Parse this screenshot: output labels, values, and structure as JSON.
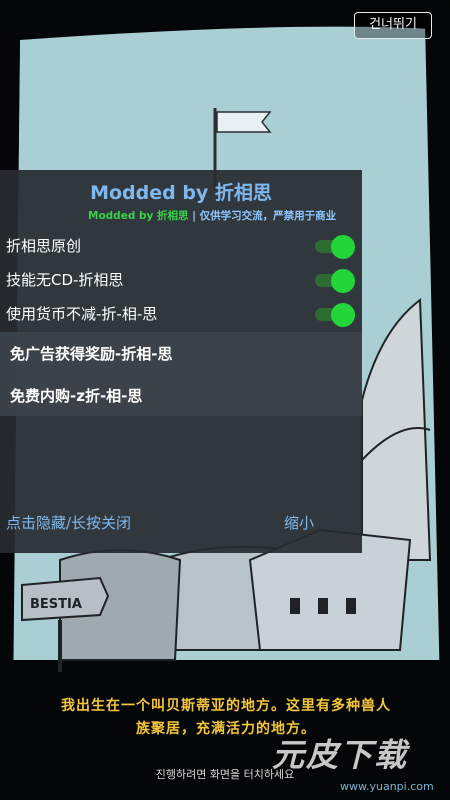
{
  "game": {
    "skip_button": "건너뛰기",
    "sign_text": "BESTIA",
    "story_line1": "我出生在一个叫贝斯蒂亚的地方。这里有多种兽人",
    "story_line2": "族聚居，充满活力的地方。",
    "tap_prompt": "진행하려면 화면을 터치하세요"
  },
  "mod_menu": {
    "title": "Modded by 折相思",
    "subtitle_author": "Modded by 折相思",
    "subtitle_note": " | 仅供学习交流，严禁用于商业",
    "toggles": [
      {
        "label": "折相思原创",
        "on": true
      },
      {
        "label": "技能无CD-折相思",
        "on": true
      },
      {
        "label": "使用货币不减-折-相-思",
        "on": true
      }
    ],
    "actions": [
      {
        "label": "免广告获得奖励-折相-思"
      },
      {
        "label": "免费内购-z折-相-思"
      }
    ],
    "hide_close": "点击隐藏/长按关闭",
    "minimize": "缩小"
  },
  "watermark": {
    "logo": "元皮下载",
    "url": "www.yuanpi.com"
  },
  "colors": {
    "sky": "#a9ced4",
    "panel_bg": "#282c32",
    "toggle_on": "#22d63a",
    "title_blue": "#7fb8ee",
    "story_gold": "#f3c63c"
  }
}
